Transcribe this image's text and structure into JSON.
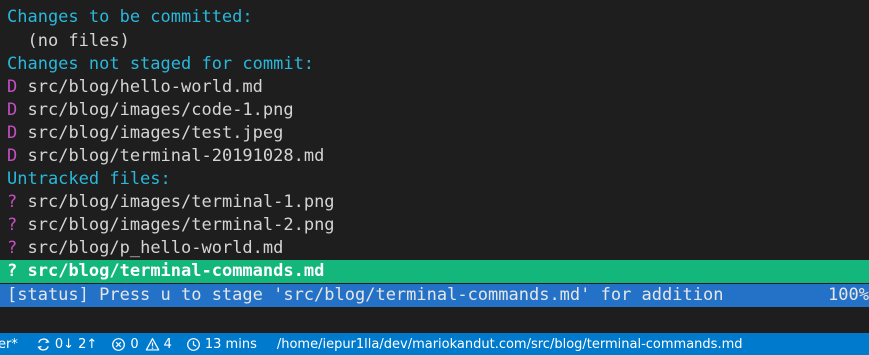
{
  "terminal": {
    "staged_header": "Changes to be committed:",
    "staged_empty": "  (no files)",
    "unstaged_header": "Changes not staged for commit:",
    "unstaged_files": [
      {
        "marker": "D",
        "path": "src/blog/hello-world.md"
      },
      {
        "marker": "D",
        "path": "src/blog/images/code-1.png"
      },
      {
        "marker": "D",
        "path": "src/blog/images/test.jpeg"
      },
      {
        "marker": "D",
        "path": "src/blog/terminal-20191028.md"
      }
    ],
    "untracked_header": "Untracked files:",
    "untracked_files": [
      {
        "marker": "?",
        "path": "src/blog/images/terminal-1.png"
      },
      {
        "marker": "?",
        "path": "src/blog/images/terminal-2.png"
      },
      {
        "marker": "?",
        "path": "src/blog/p_hello-world.md"
      },
      {
        "marker": "?",
        "path": "src/blog/terminal-commands.md"
      }
    ],
    "status_message": "[status] Press u to stage 'src/blog/terminal-commands.md' for addition",
    "status_percent": "100%"
  },
  "statusbar": {
    "branch": "er*",
    "sync": "0↓ 2↑",
    "errors": "0",
    "warnings": "4",
    "time": "13 mins",
    "path": "/home/iepur1lla/dev/mariokandut.com/src/blog/terminal-commands.md"
  },
  "colors": {
    "background": "#1e1e1e",
    "header": "#29b8db",
    "marker": "#c44ec4",
    "selected": "#13b77b",
    "status_line": "#2472c8",
    "statusbar": "#007acc"
  }
}
